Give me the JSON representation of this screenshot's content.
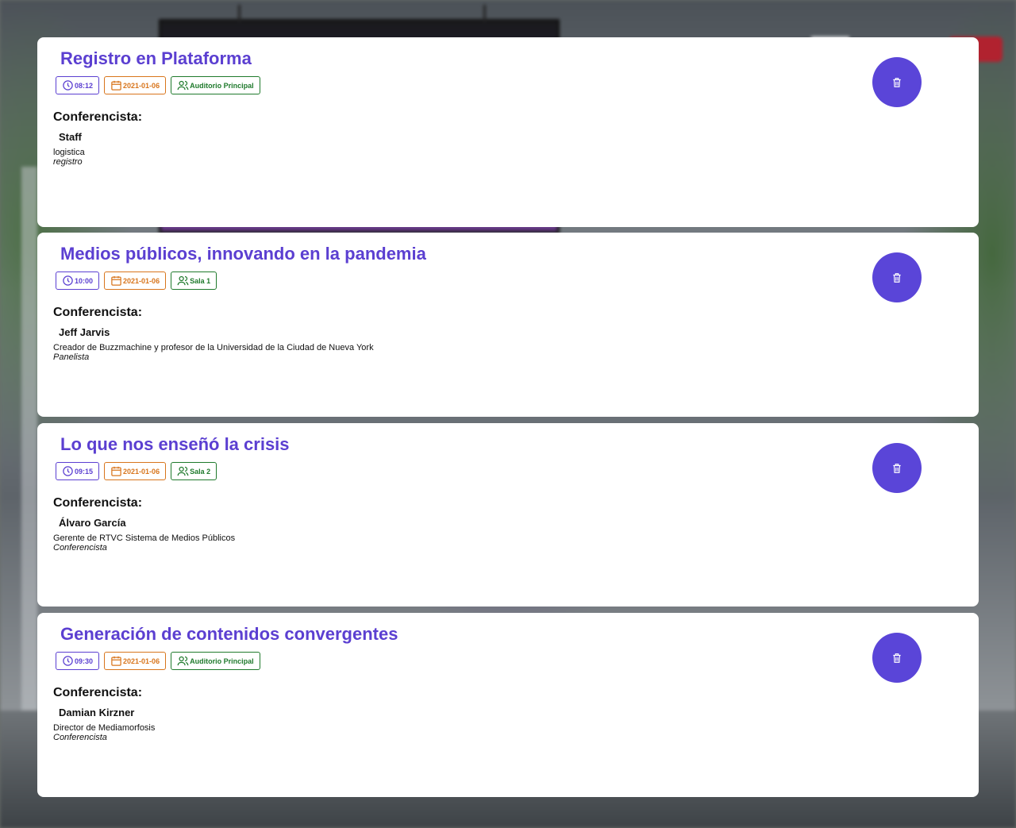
{
  "speaker_heading": "Conferencista:",
  "colors": {
    "accent": "#5b3fd1",
    "time": "#5b3fd1",
    "date": "#d8751c",
    "room": "#1f7a2c",
    "delete_button": "#5a45d8"
  },
  "icons": {
    "time": "clock-icon",
    "date": "calendar-icon",
    "room": "users-icon",
    "delete": "trash-icon"
  },
  "events": [
    {
      "title": "Registro en Plataforma",
      "time": "08:12",
      "date": "2021-01-06",
      "room": "Auditorio Principal",
      "speaker": {
        "name": "Staff",
        "description": "logistica",
        "role": "registro"
      }
    },
    {
      "title": "Medios públicos, innovando en la pandemia",
      "time": "10:00",
      "date": "2021-01-06",
      "room": "Sala 1",
      "speaker": {
        "name": "Jeff Jarvis",
        "description": "Creador de Buzzmachine y profesor de la Universidad de la Ciudad de Nueva York",
        "role": "Panelista"
      }
    },
    {
      "title": "Lo que nos enseñó la crisis",
      "time": "09:15",
      "date": "2021-01-06",
      "room": "Sala 2",
      "speaker": {
        "name": "Álvaro García",
        "description": "Gerente de RTVC Sistema de Medios Públicos",
        "role": "Conferencista"
      }
    },
    {
      "title": "Generación de contenidos convergentes",
      "time": "09:30",
      "date": "2021-01-06",
      "room": "Auditorio Principal",
      "speaker": {
        "name": "Damian Kirzner",
        "description": "Director de Mediamorfosis",
        "role": "Conferencista"
      }
    }
  ]
}
